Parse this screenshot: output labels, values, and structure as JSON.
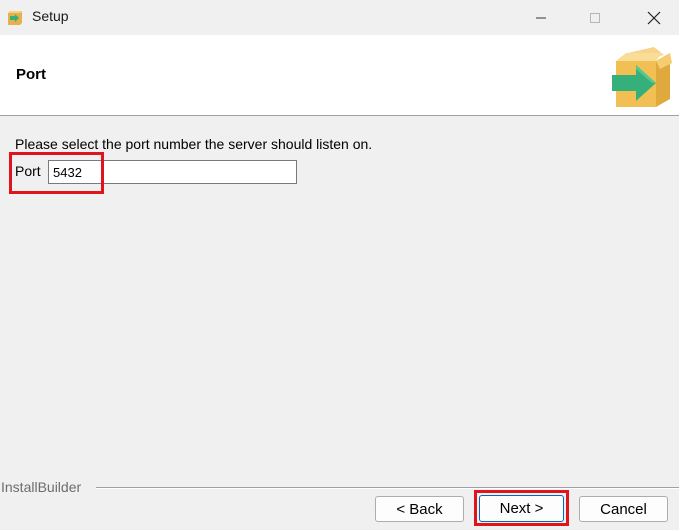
{
  "window": {
    "title": "Setup",
    "controls": [
      "minimize",
      "maximize",
      "close"
    ]
  },
  "header": {
    "title": "Port",
    "logo_icon": "package-arrow-icon"
  },
  "body": {
    "prompt": "Please select the port number the server should listen on.",
    "port_label": "Port",
    "port_value": "5432"
  },
  "footer": {
    "brand": "InstallBuilder",
    "back_label": "< Back",
    "next_label": "Next >",
    "cancel_label": "Cancel"
  },
  "colors": {
    "highlight": "#e0141e",
    "logo_box": "#f2bf55",
    "logo_arrow": "#36b07a"
  }
}
